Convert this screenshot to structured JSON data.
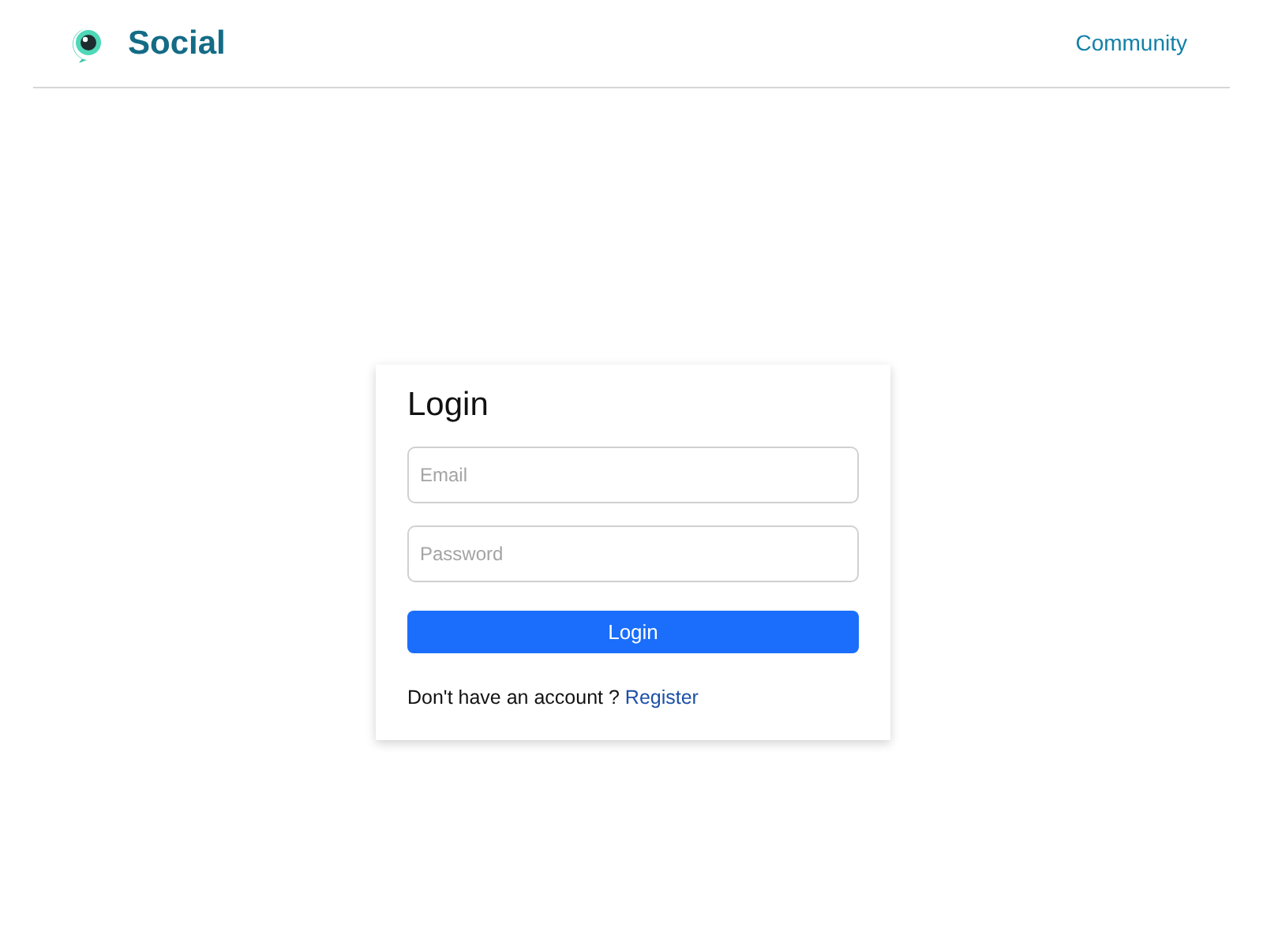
{
  "header": {
    "brand": "Social",
    "nav": [
      {
        "label": "Community"
      }
    ]
  },
  "login": {
    "title": "Login",
    "fields": [
      {
        "placeholder": "Email"
      },
      {
        "placeholder": "Password"
      }
    ],
    "button": "Login",
    "prompt": "Don't have an account ?",
    "link": "Register"
  }
}
